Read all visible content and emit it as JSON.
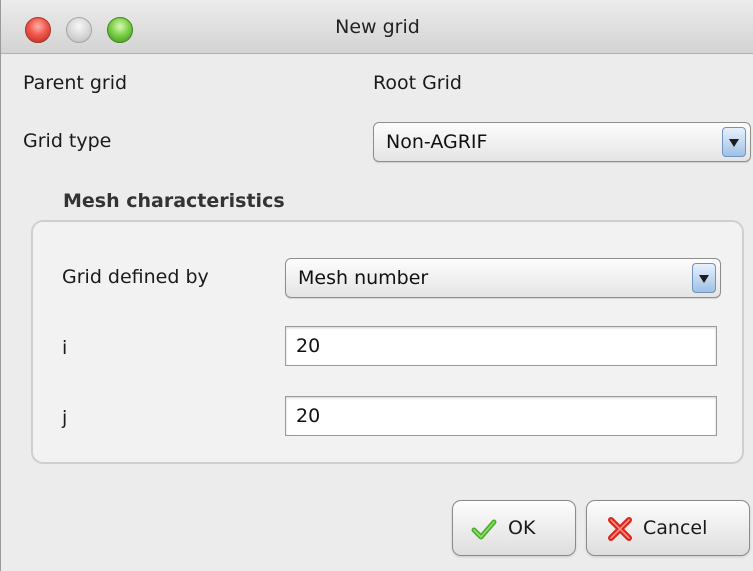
{
  "window": {
    "title": "New grid"
  },
  "form": {
    "parent_grid_label": "Parent grid",
    "parent_grid_value": "Root Grid",
    "grid_type_label": "Grid type",
    "grid_type_value": "Non-AGRIF"
  },
  "mesh": {
    "title": "Mesh characteristics",
    "grid_defined_by_label": "Grid defined by",
    "grid_defined_by_value": "Mesh number",
    "i_label": "i",
    "i_value": "20",
    "j_label": "j",
    "j_value": "20"
  },
  "buttons": {
    "ok_label": "OK",
    "ok_icon": "checkmark-icon",
    "cancel_label": "Cancel",
    "cancel_icon": "red-x-icon"
  },
  "colors": {
    "close": "#f0574c",
    "minimize": "#d9d9d9",
    "zoom": "#7fd04a",
    "check": "#4caf2a",
    "cancel_x": "#d8261c"
  }
}
